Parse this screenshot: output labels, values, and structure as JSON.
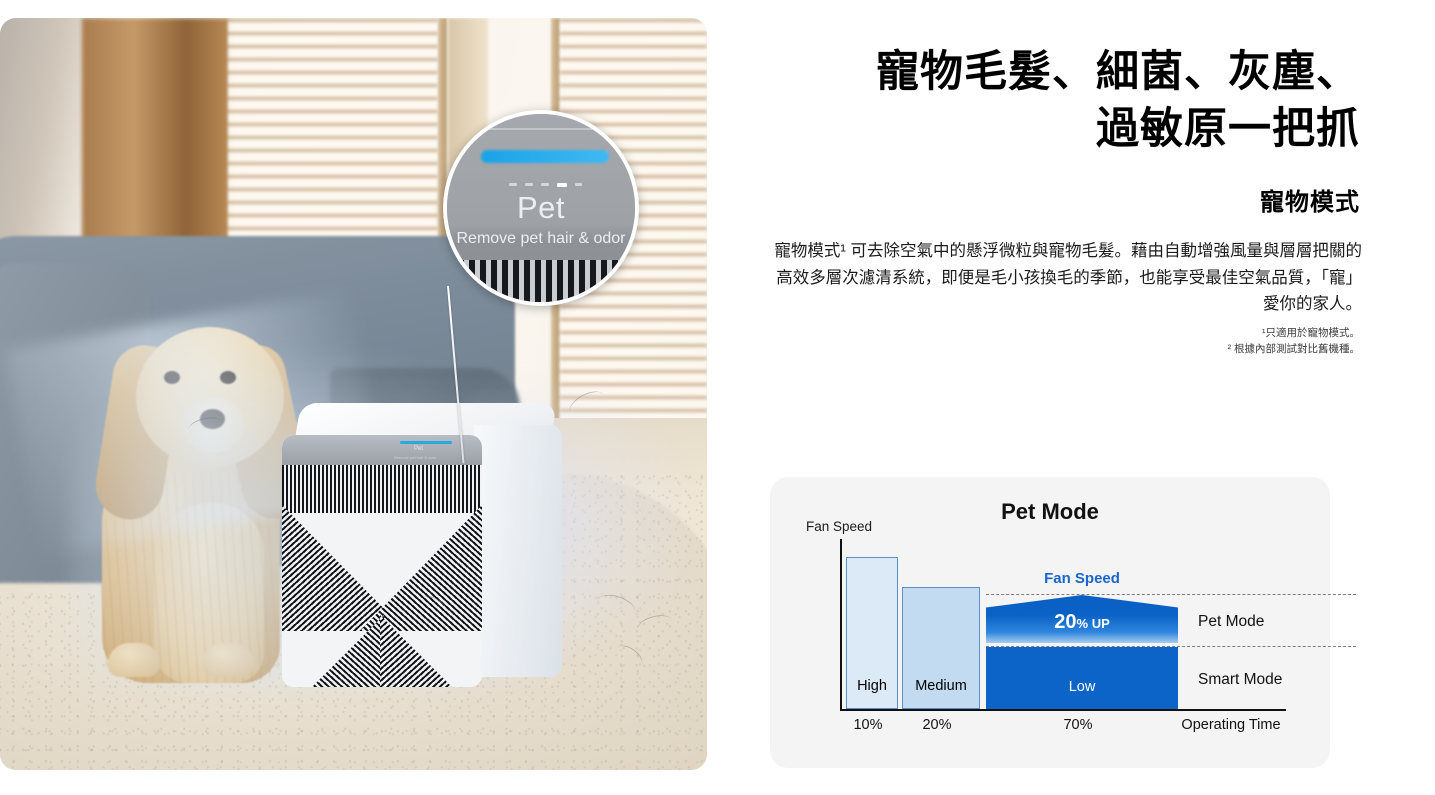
{
  "photo": {
    "alt_name": "pet-air-purifier-lifestyle-photo",
    "magnifier": {
      "mode_label": "Pet",
      "mode_description": "Remove pet hair & odor"
    }
  },
  "copy": {
    "headline_line1": "寵物毛髮、細菌、灰塵、",
    "headline_line2": "過敏原一把抓",
    "subtitle": "寵物模式",
    "body": "寵物模式¹ 可去除空氣中的懸浮微粒與寵物毛髮。藉由自動增強風量與層層把關的高效多層次濾清系統，即便是毛小孩換毛的季節，也能享受最佳空氣品質，「寵」愛你的家人。",
    "footnote1": "¹只適用於寵物模式。",
    "footnote2": "² 根據內部測試對比舊機種。"
  },
  "colors": {
    "accent_blue": "#0c64c8",
    "legend_blue": "#1966cf",
    "bar_high": "#dce9f7",
    "bar_medium": "#c3dbf0",
    "bar_outline": "#5b8fc9",
    "panel_bg": "#f4f4f4"
  },
  "chart_data": {
    "type": "bar",
    "title": "Pet Mode",
    "ylabel": "Fan Speed",
    "xlabel": "Operating Time",
    "categories": [
      "High",
      "Medium",
      "Low"
    ],
    "tick_labels": [
      "10%",
      "20%",
      "70%"
    ],
    "values": [
      100,
      80,
      41
    ],
    "ylim": [
      0,
      112
    ],
    "grid": false,
    "legend_position": "inside-right",
    "series": [
      {
        "name": "Fan Speed",
        "values": [
          100,
          80,
          41
        ],
        "bar_labels": [
          "High",
          "Medium",
          "Low"
        ]
      }
    ],
    "annotations": {
      "legend_inline": "Fan Speed",
      "uplift_value": "20",
      "uplift_unit": "%",
      "uplift_suffix": "UP",
      "row_label_top": "Pet Mode",
      "row_label_bottom": "Smart Mode"
    },
    "operating_time_share": {
      "High": "10%",
      "Medium": "20%",
      "Low": "70%"
    }
  }
}
